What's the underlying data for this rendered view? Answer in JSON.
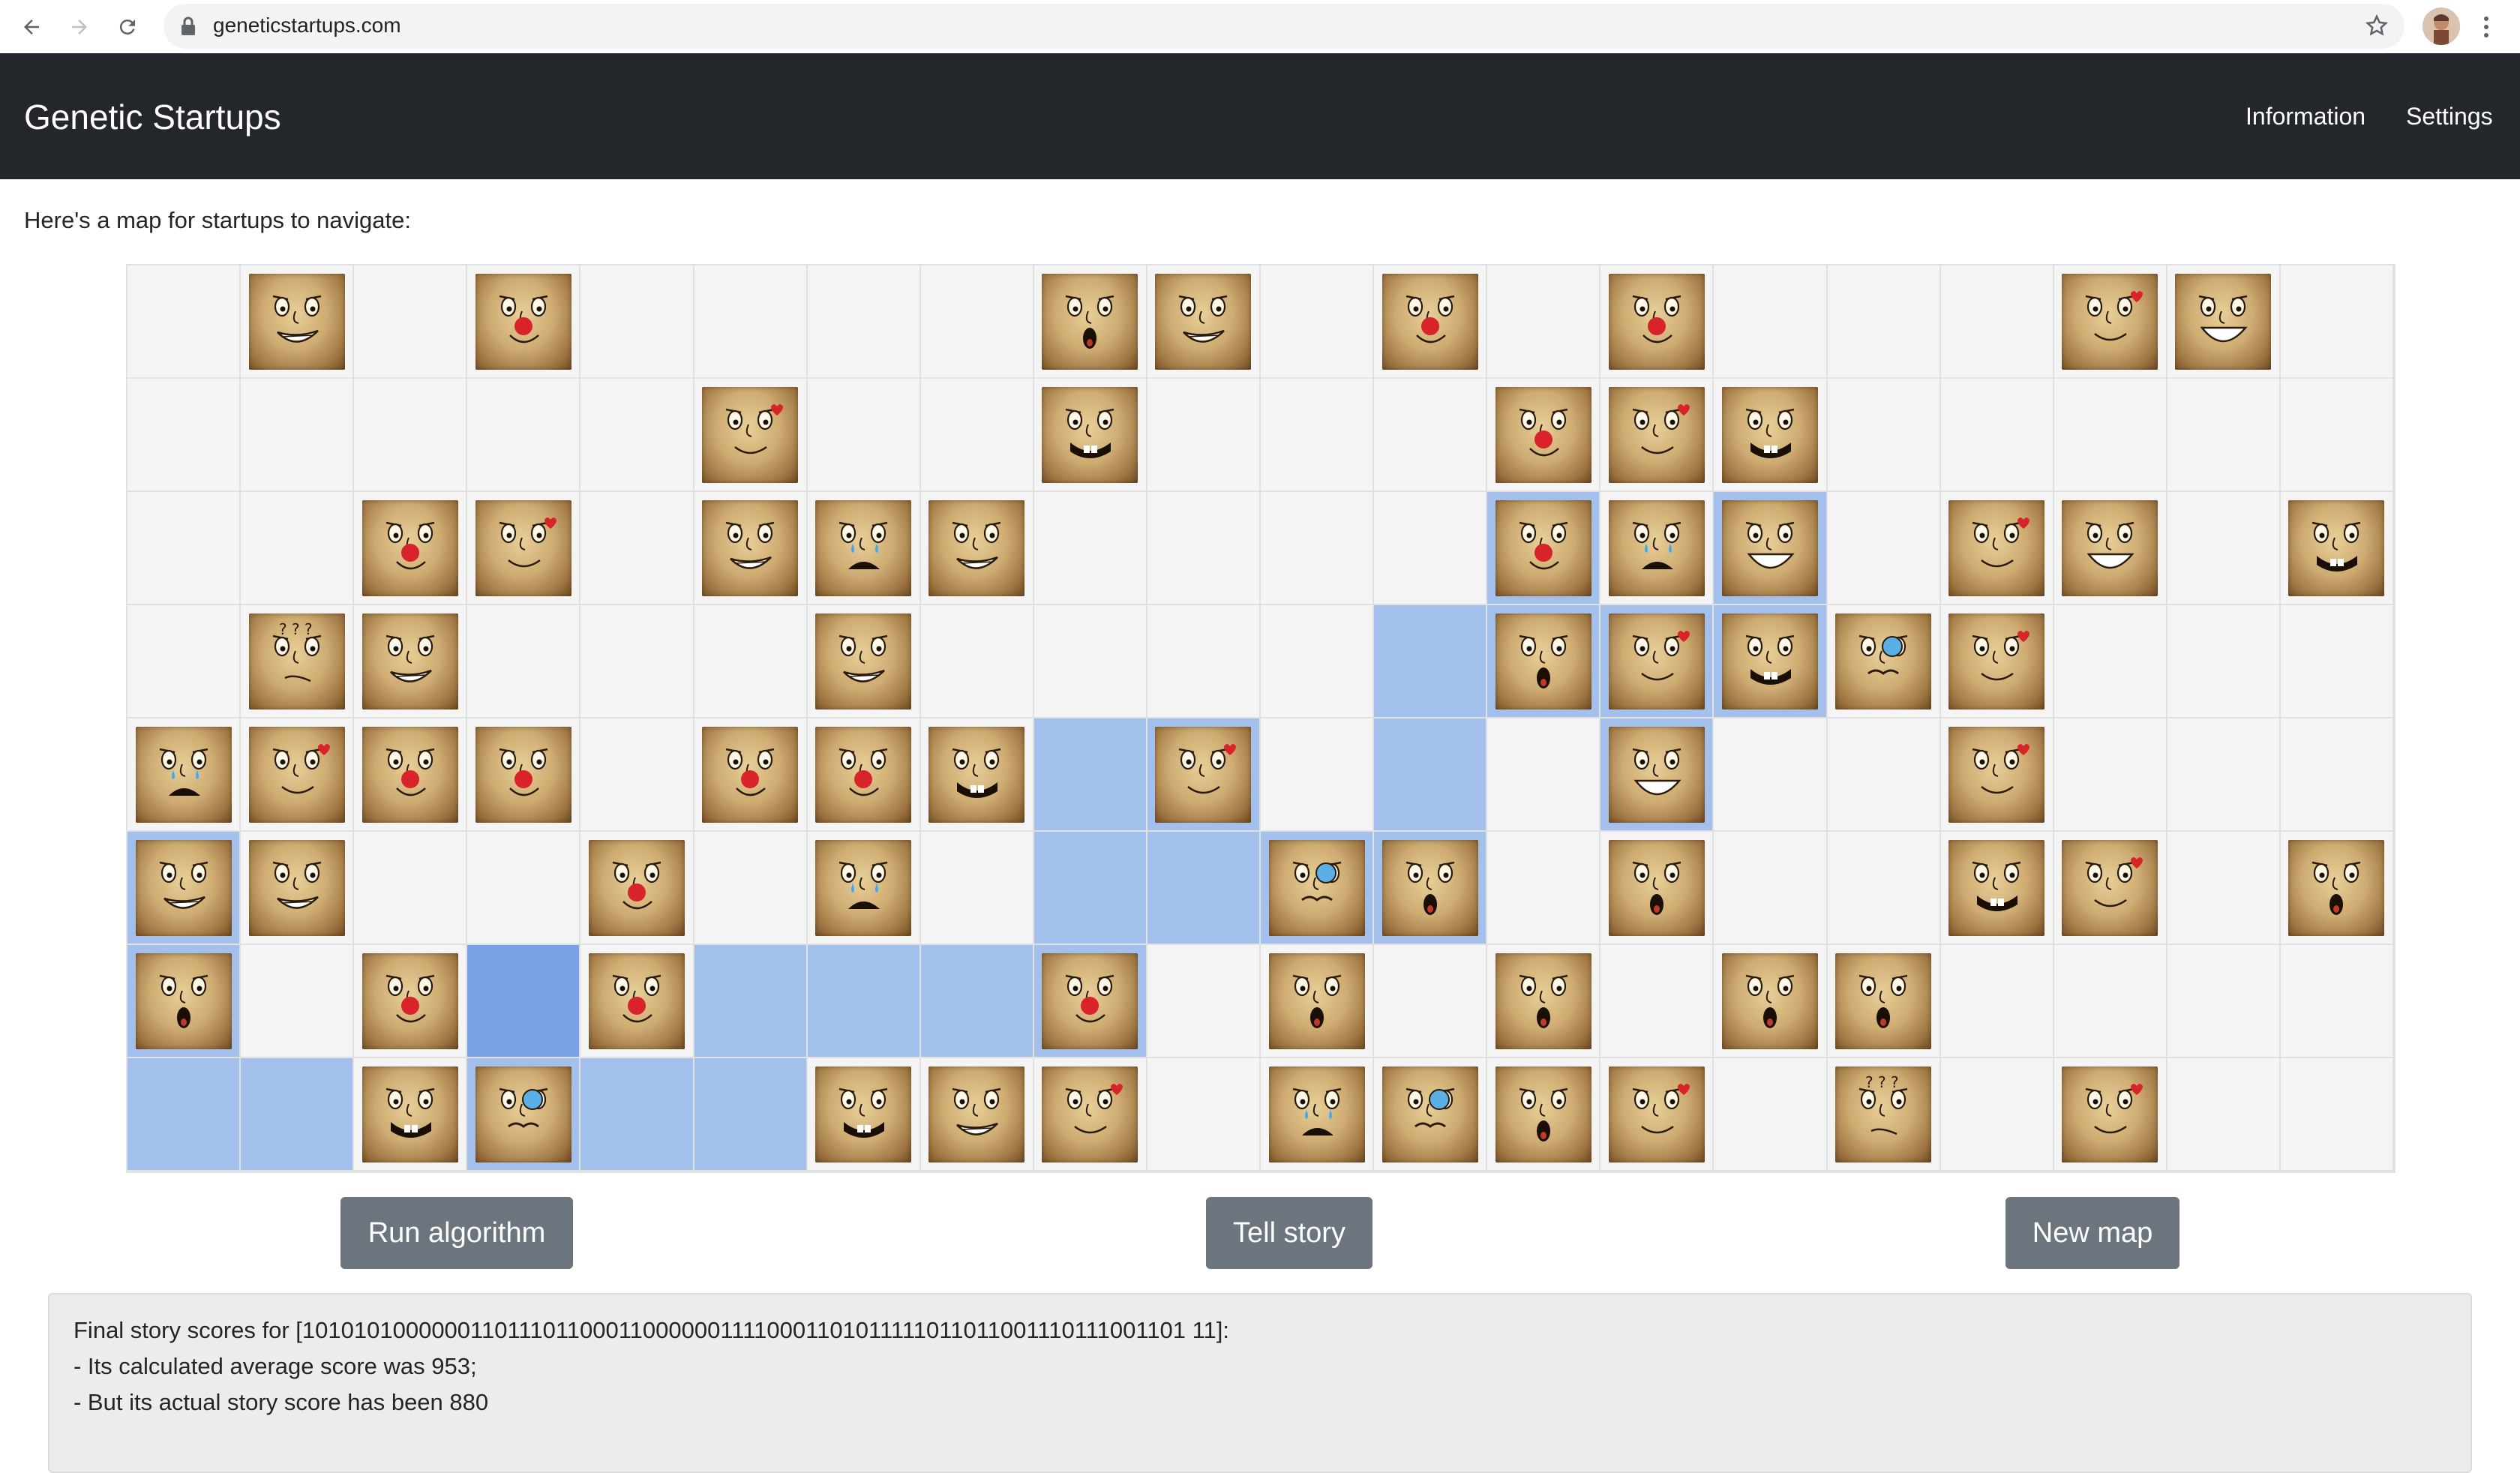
{
  "browser": {
    "url": "geneticstartups.com",
    "icons": [
      "back-arrow-icon",
      "forward-arrow-icon",
      "reload-icon",
      "lock-icon",
      "star-icon",
      "kebab-menu-icon"
    ]
  },
  "navbar": {
    "brand": "Genetic Startups",
    "links": [
      "Information",
      "Settings"
    ]
  },
  "intro": "Here's a map for startups to navigate:",
  "grid": {
    "columns": 20,
    "rows": 8,
    "cells": [
      "....,....n...n...n...",
      "x"
    ],
    "map": [
      [
        ".",
        "E",
        ".",
        "C",
        ".",
        ".",
        ".",
        ".",
        "S",
        "E",
        ".",
        "C",
        ".",
        "C",
        ".",
        ".",
        ".",
        "L",
        "G",
        "."
      ],
      [
        ".",
        ".",
        ".",
        ".",
        ".",
        "L",
        ".",
        ".",
        "B",
        ".",
        ".",
        ".",
        "C",
        "L",
        "B",
        ".",
        ".",
        ".",
        ".",
        "."
      ],
      [
        ".",
        ".",
        "C",
        "L",
        ".",
        "E",
        "K",
        "E",
        ".",
        ".",
        ".",
        ".",
        "C",
        "K",
        "G",
        ".",
        "L",
        "G",
        ".",
        "B"
      ],
      [
        ".",
        "Q",
        "E",
        ".",
        ".",
        ".",
        "E",
        ".",
        ".",
        ".",
        ".",
        ".",
        "S",
        "L",
        "B",
        "M",
        "L",
        ".",
        ".",
        "."
      ],
      [
        "K",
        "L",
        "C",
        "C",
        ".",
        "C",
        "C",
        "B",
        ".",
        "L",
        ".",
        ".",
        ".",
        "G",
        ".",
        ".",
        "L",
        ".",
        ".",
        "."
      ],
      [
        "E",
        "E",
        ".",
        ".",
        "C",
        ".",
        "K",
        ".",
        ".",
        ".",
        "M",
        "S",
        ".",
        "S",
        ".",
        ".",
        "B",
        "L",
        ".",
        "S"
      ],
      [
        "S",
        ".",
        "C",
        ".",
        "C",
        ".",
        ".",
        ".",
        "C",
        ".",
        "S",
        ".",
        "S",
        ".",
        "S",
        "S",
        ".",
        ".",
        ".",
        "."
      ],
      [
        ".",
        ".",
        "B",
        "M",
        ".",
        ".",
        "B",
        "E",
        "L",
        ".",
        "K",
        "M",
        "S",
        "L",
        ".",
        "Q",
        ".",
        "L",
        ".",
        "."
      ]
    ],
    "path": [
      [
        0,
        0,
        0,
        0,
        0,
        0,
        0,
        0,
        0,
        0,
        0,
        0,
        0,
        0,
        0,
        0,
        0,
        0,
        0,
        0
      ],
      [
        0,
        0,
        0,
        0,
        0,
        0,
        0,
        0,
        0,
        0,
        0,
        0,
        0,
        0,
        0,
        0,
        0,
        0,
        0,
        0
      ],
      [
        0,
        0,
        0,
        0,
        0,
        0,
        0,
        0,
        0,
        0,
        0,
        0,
        1,
        0,
        1,
        0,
        0,
        0,
        0,
        0
      ],
      [
        0,
        0,
        0,
        0,
        0,
        0,
        0,
        0,
        0,
        0,
        0,
        1,
        1,
        1,
        1,
        0,
        0,
        0,
        0,
        0
      ],
      [
        0,
        0,
        0,
        0,
        0,
        0,
        0,
        0,
        1,
        1,
        0,
        1,
        0,
        1,
        0,
        0,
        0,
        0,
        0,
        0
      ],
      [
        1,
        0,
        0,
        0,
        0,
        0,
        0,
        0,
        1,
        1,
        1,
        1,
        0,
        0,
        0,
        0,
        0,
        0,
        0,
        0
      ],
      [
        1,
        0,
        0,
        2,
        0,
        1,
        1,
        1,
        1,
        0,
        0,
        0,
        0,
        0,
        0,
        0,
        0,
        0,
        0,
        0
      ],
      [
        1,
        1,
        0,
        1,
        1,
        1,
        0,
        0,
        0,
        0,
        0,
        0,
        0,
        0,
        0,
        0,
        0,
        0,
        0,
        0
      ]
    ],
    "face_types": {
      "E": "grinning-face-icon",
      "C": "clown-nose-face-icon",
      "S": "surprised-face-icon",
      "L": "love-struck-face-icon",
      "G": "big-smile-face-icon",
      "B": "buck-toothed-face-icon",
      "K": "crying-face-icon",
      "Q": "confused-face-icon",
      "M": "monocle-face-icon"
    }
  },
  "buttons": {
    "run": "Run algorithm",
    "story": "Tell story",
    "new_map": "New map"
  },
  "result": {
    "line1": "Final story scores for [10101010000001101110110001100000011110001101011111011011001110111001101 11]:",
    "line2": "- Its calculated average score was 953;",
    "line3": "- But its actual story score has been 880"
  },
  "colors": {
    "navbar_bg": "#23272b",
    "path_cell": "#a3c0ec",
    "current_cell": "#7aa3e6",
    "button_bg": "#6c757d"
  }
}
